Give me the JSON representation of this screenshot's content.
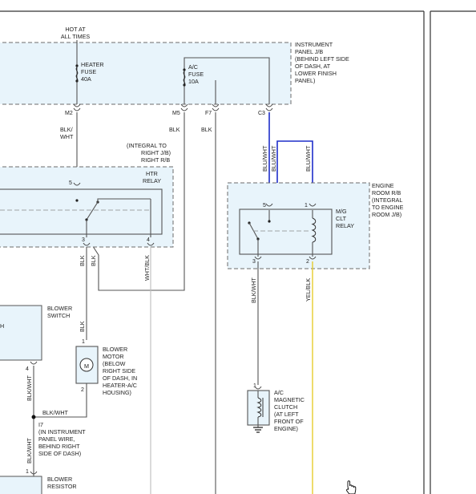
{
  "hot_at_all_times": [
    "HOT AT",
    "ALL TIMES"
  ],
  "instrument_panel_jb": [
    "INSTRUMENT",
    "PANEL J/B",
    "(BEHIND LEFT SIDE",
    "OF DASH, AT",
    "LOWER FINISH",
    "PANEL)"
  ],
  "heater_fuse": [
    "HEATER",
    "FUSE",
    "40A"
  ],
  "ac_fuse": [
    "A/C",
    "FUSE",
    "10A"
  ],
  "connectors": {
    "m2": "M2",
    "m5": "M5",
    "f7": "F7",
    "c3": "C3"
  },
  "wire_colors": {
    "blk_wht": [
      "BLK/",
      "WHT"
    ],
    "blk": "BLK",
    "blu_wht": "BLU/WHT",
    "wht_blk": "WHT/BLK",
    "blk_wht_single": "BLK/WHT",
    "yel_blk": "YEL/BLK"
  },
  "right_rb": [
    "(INTEGRAL TO",
    "RIGHT J/B)",
    "RIGHT R/B"
  ],
  "htr_relay": [
    "HTR",
    "RELAY"
  ],
  "engine_room_rb": [
    "ENGINE",
    "ROOM R/B",
    "(INTEGRAL",
    "TO ENGINE",
    "ROOM J/B)"
  ],
  "mg_clt_relay": [
    "M/G",
    "CLT",
    "RELAY"
  ],
  "blower_switch": [
    "BLOWER",
    "SWITCH"
  ],
  "blower_switch_partial": "H",
  "blower_motor": [
    "BLOWER",
    "MOTOR",
    "(BELOW",
    "RIGHT SIDE",
    "OF DASH, IN",
    "HEATER-A/C",
    "HOUSING)"
  ],
  "motor_symbol": "M",
  "splice": [
    "I7",
    "(IN INSTRUMENT",
    "PANEL WIRE,",
    "BEHIND RIGHT",
    "SIDE OF DASH)"
  ],
  "ac_clutch": [
    "A/C",
    "MAGNETIC",
    "CLUTCH",
    "(AT LEFT",
    "FRONT OF",
    "ENGINE)"
  ],
  "blower_resistor": [
    "BLOWER",
    "RESISTOR"
  ],
  "pins": {
    "htr_5": "5",
    "htr_3": "3",
    "htr_4": "4",
    "mg_5": "5",
    "mg_1": "1",
    "mg_3": "3",
    "mg_2": "2",
    "sw_4": "4",
    "motor_1": "1",
    "motor_2": "2",
    "clutch_1": "1",
    "res_1": "1"
  },
  "colors": {
    "box_fill": "#e8f4fb",
    "blue_wire": "#1f2ec9",
    "yellow_wire": "#e6cc2e",
    "grey_wire": "#bdbdbd"
  }
}
